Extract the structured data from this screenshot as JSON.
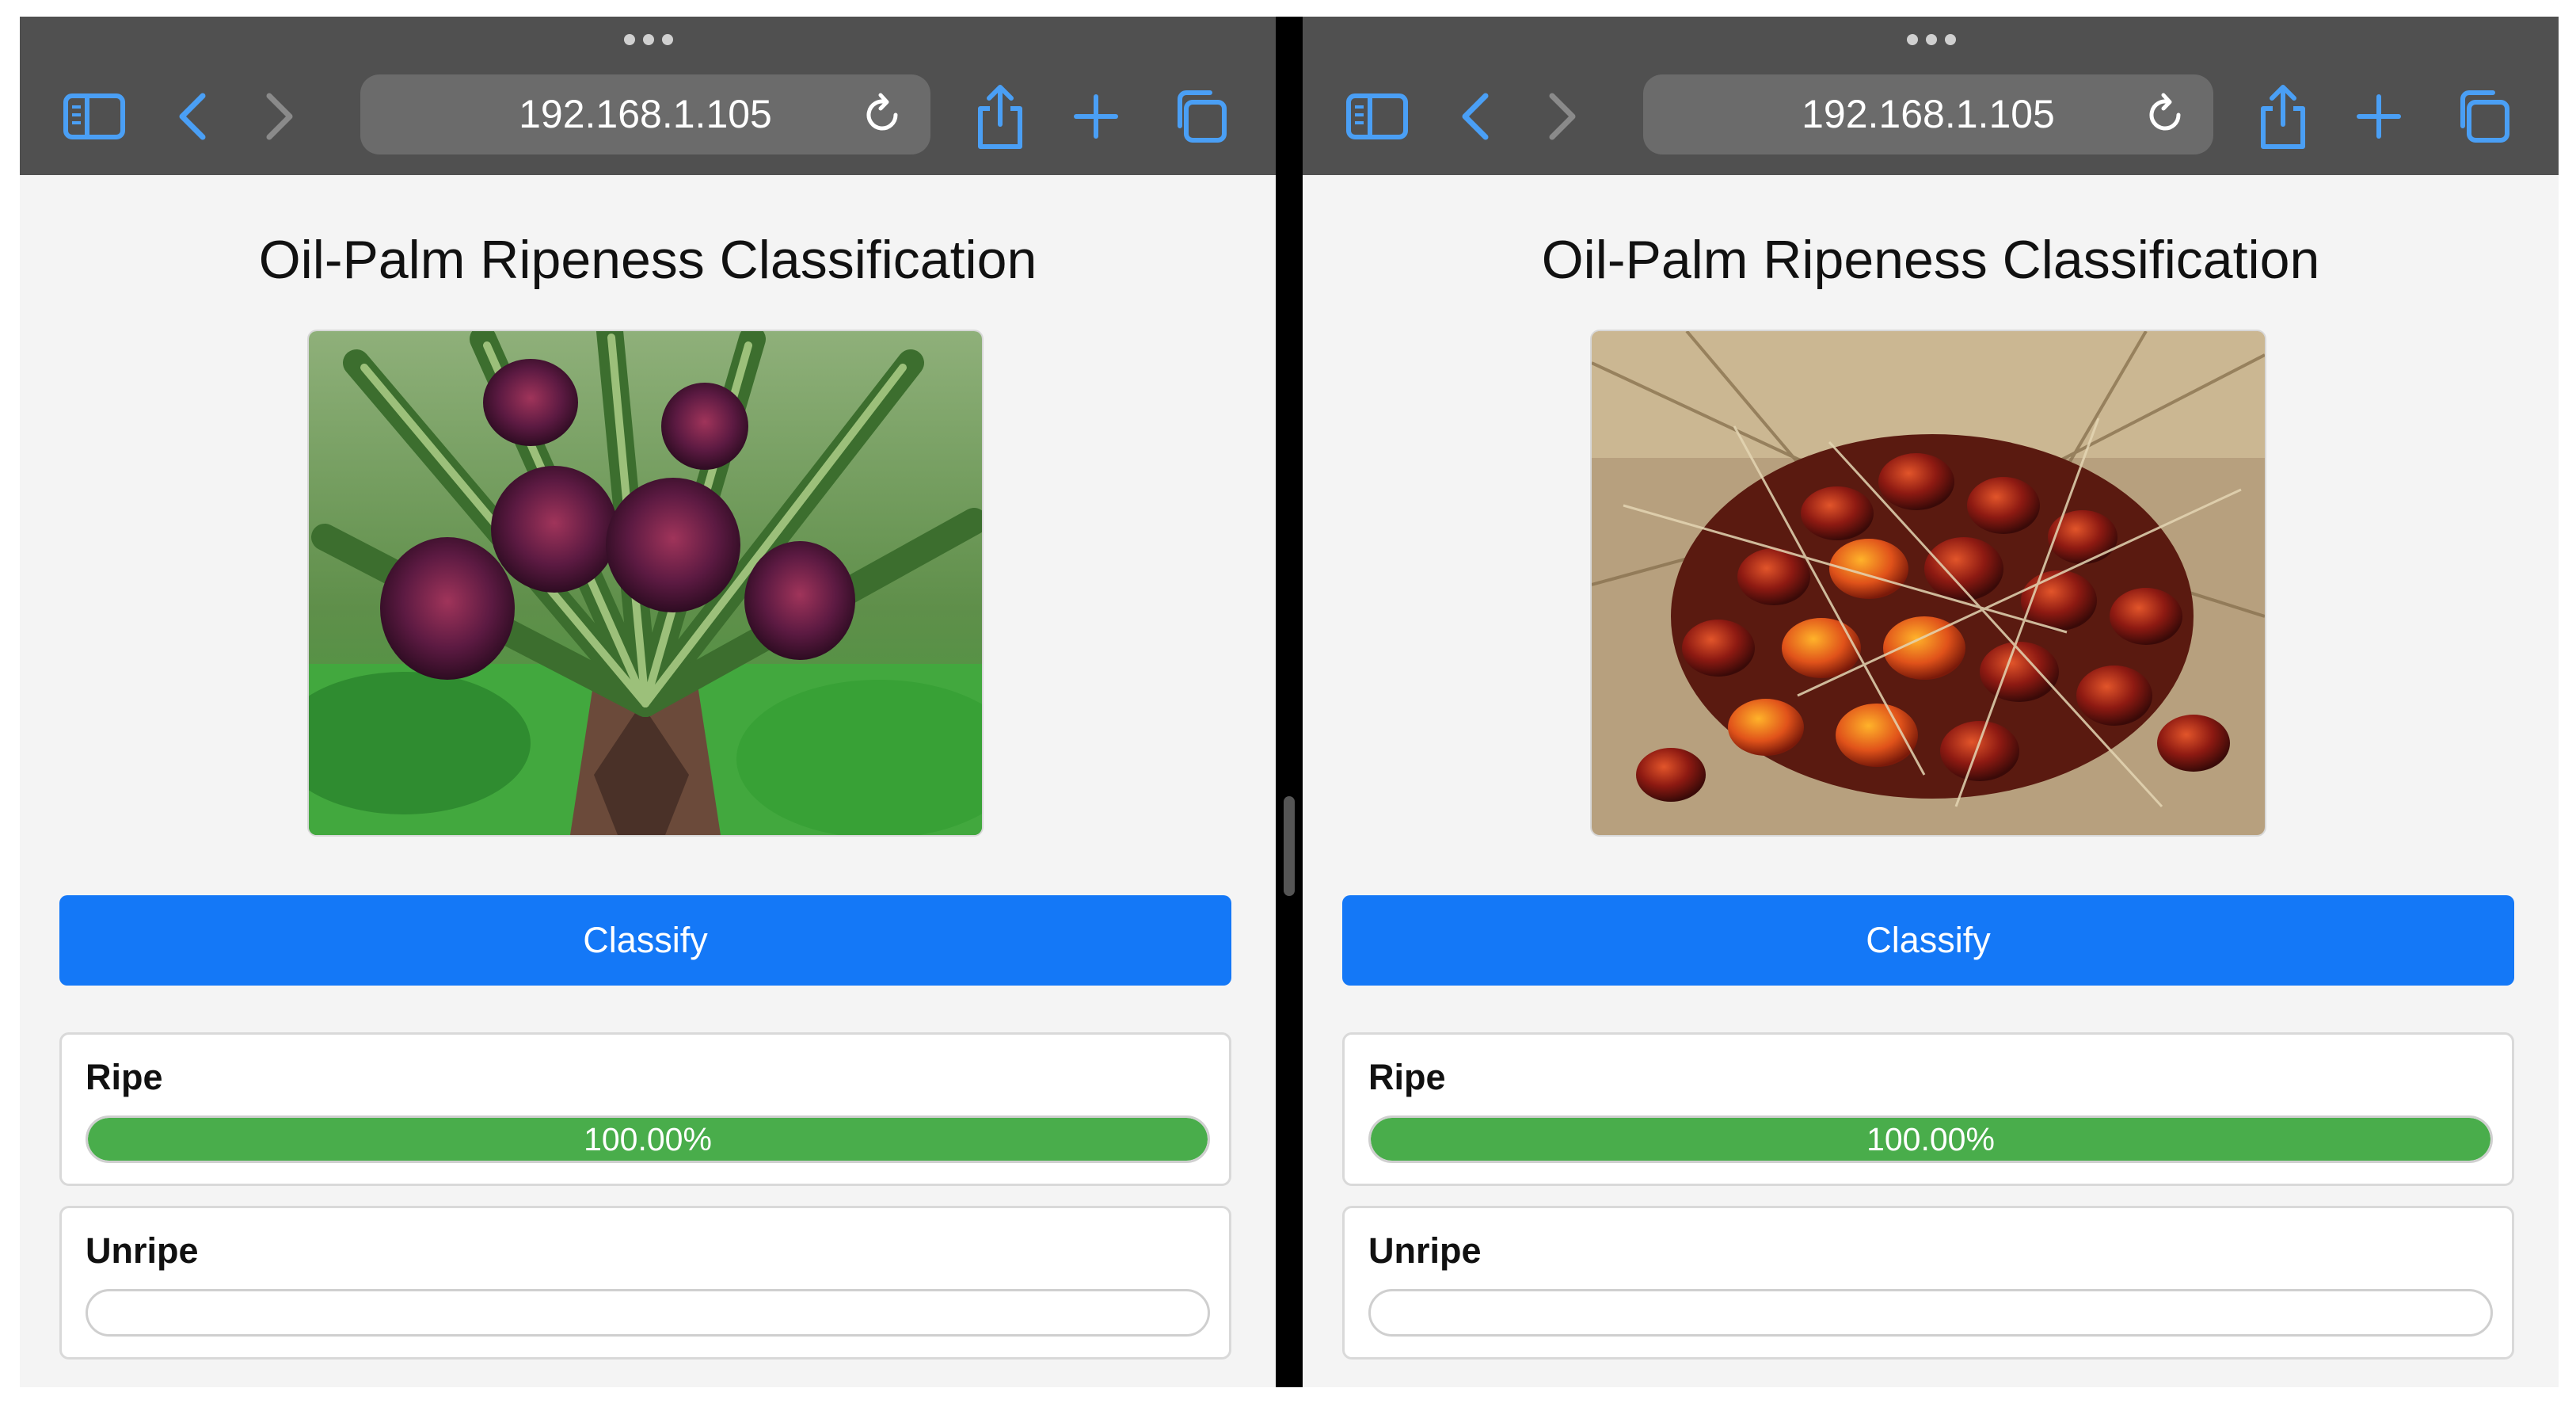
{
  "panes": [
    {
      "browser": {
        "url": "192.168.1.105"
      },
      "page": {
        "title": "Oil-Palm Ripeness Classification",
        "image_subject": "oil palm tree with unharvested purple fruit bunches",
        "classify_label": "Classify",
        "results": [
          {
            "label": "Ripe",
            "percent": 100,
            "percent_text": "100.00%"
          },
          {
            "label": "Unripe",
            "percent": 0,
            "percent_text": ""
          }
        ]
      }
    },
    {
      "browser": {
        "url": "192.168.1.105"
      },
      "page": {
        "title": "Oil-Palm Ripeness Classification",
        "image_subject": "harvested oil palm fruit bunch with red-orange fruits",
        "classify_label": "Classify",
        "results": [
          {
            "label": "Ripe",
            "percent": 100,
            "percent_text": "100.00%"
          },
          {
            "label": "Unripe",
            "percent": 0,
            "percent_text": ""
          }
        ]
      }
    }
  ],
  "colors": {
    "toolbar": "#505050",
    "icon_accent": "#4a9ff5",
    "button": "#1478f7",
    "progress_fill": "#49ad4b"
  },
  "icons": [
    "sidebar-icon",
    "back-chevron-icon",
    "forward-chevron-icon",
    "reload-icon",
    "share-icon",
    "new-tab-plus-icon",
    "tabs-overview-icon",
    "more-dots-icon"
  ]
}
